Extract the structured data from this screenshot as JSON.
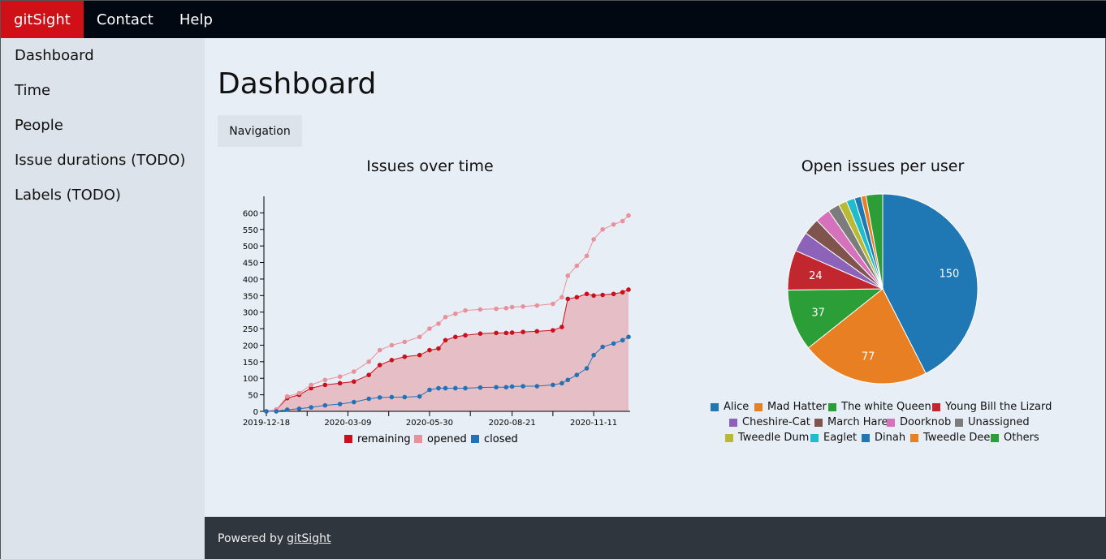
{
  "nav": {
    "brand": "gitSight",
    "contact": "Contact",
    "help": "Help"
  },
  "sidebar": {
    "items": [
      {
        "label": "Dashboard"
      },
      {
        "label": "Time"
      },
      {
        "label": "People"
      },
      {
        "label": "Issue durations (TODO)"
      },
      {
        "label": "Labels (TODO)"
      }
    ]
  },
  "main": {
    "title": "Dashboard",
    "navigation_button": "Navigation"
  },
  "footer": {
    "text": "Powered by",
    "link": "gitSight"
  },
  "colors": {
    "remaining": "#cc0f1a",
    "opened": "#e8919a",
    "closed": "#2372b6",
    "area_fill": "#e6bfc6"
  },
  "chart_data": [
    {
      "type": "line",
      "title": "Issues over time",
      "x_tick_labels": [
        "2019-12-18",
        "2020-03-09",
        "2020-05-30",
        "2020-08-21",
        "2020-11-11"
      ],
      "y_ticks": [
        0,
        50,
        100,
        150,
        200,
        250,
        300,
        350,
        400,
        450,
        500,
        550,
        600
      ],
      "ylim": [
        0,
        650
      ],
      "x": [
        "2019-12-18",
        "2019-12-28",
        "2020-01-08",
        "2020-01-20",
        "2020-02-01",
        "2020-02-15",
        "2020-03-01",
        "2020-03-15",
        "2020-03-30",
        "2020-04-10",
        "2020-04-22",
        "2020-05-05",
        "2020-05-20",
        "2020-05-30",
        "2020-06-08",
        "2020-06-15",
        "2020-06-25",
        "2020-07-05",
        "2020-07-20",
        "2020-08-05",
        "2020-08-15",
        "2020-08-21",
        "2020-09-01",
        "2020-09-15",
        "2020-10-01",
        "2020-10-10",
        "2020-10-16",
        "2020-10-25",
        "2020-11-04",
        "2020-11-11",
        "2020-11-20",
        "2020-12-01",
        "2020-12-10",
        "2020-12-16"
      ],
      "series": [
        {
          "name": "remaining",
          "values": [
            0,
            5,
            40,
            50,
            70,
            80,
            85,
            90,
            110,
            140,
            155,
            165,
            170,
            185,
            190,
            215,
            225,
            230,
            235,
            237,
            237,
            238,
            240,
            242,
            245,
            255,
            340,
            345,
            355,
            350,
            352,
            355,
            360,
            368
          ]
        },
        {
          "name": "opened",
          "values": [
            0,
            5,
            45,
            55,
            80,
            95,
            105,
            120,
            150,
            185,
            200,
            210,
            225,
            250,
            265,
            285,
            295,
            305,
            308,
            310,
            312,
            315,
            317,
            320,
            325,
            345,
            410,
            440,
            470,
            520,
            550,
            565,
            575,
            592
          ]
        },
        {
          "name": "closed",
          "values": [
            0,
            0,
            5,
            8,
            12,
            18,
            22,
            28,
            38,
            42,
            43,
            43,
            45,
            65,
            70,
            70,
            70,
            70,
            72,
            73,
            73,
            75,
            76,
            76,
            80,
            85,
            95,
            110,
            130,
            170,
            195,
            205,
            215,
            225
          ]
        }
      ],
      "legend": [
        "remaining",
        "opened",
        "closed"
      ]
    },
    {
      "type": "pie",
      "title": "Open issues per user",
      "labels": [
        "Alice",
        "Mad Hatter",
        "The white Queen",
        "Young Bill the Lizard",
        "Cheshire-Cat",
        "March Hare",
        "Doorknob",
        "Unassigned",
        "Tweedle Dum",
        "Eaglet",
        "Dinah",
        "Tweedle Dee",
        "Others"
      ],
      "values": [
        150,
        77,
        37,
        24,
        12,
        10,
        9,
        7,
        5,
        5,
        4,
        3,
        10
      ],
      "value_labels_shown": [
        "150",
        "77",
        "37",
        "24"
      ],
      "colors": [
        "#1f77b4",
        "#e87f22",
        "#2b9e38",
        "#c2272f",
        "#8d63b9",
        "#7f544c",
        "#d671bc",
        "#7c7c7c",
        "#b9ba31",
        "#1ebccd",
        "#1f77b4",
        "#e87f22",
        "#2b9e38"
      ]
    }
  ]
}
